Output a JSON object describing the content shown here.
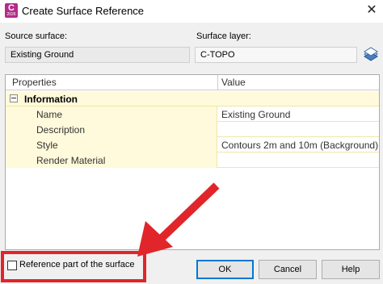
{
  "window": {
    "app_icon_letter": "C",
    "app_icon_year": "2026",
    "title": "Create Surface Reference"
  },
  "source": {
    "label": "Source surface:",
    "value": "Existing Ground"
  },
  "layer": {
    "label": "Surface layer:",
    "value": "C-TOPO"
  },
  "grid": {
    "col_properties": "Properties",
    "col_value": "Value",
    "category": "Information",
    "rows": [
      {
        "name": "Name",
        "value": "Existing Ground"
      },
      {
        "name": "Description",
        "value": ""
      },
      {
        "name": "Style",
        "value": "Contours 2m and 10m (Background)"
      },
      {
        "name": "Render Material",
        "value": ""
      }
    ]
  },
  "reference_part": {
    "label": "Reference part of the surface",
    "checked": false
  },
  "buttons": {
    "ok": "OK",
    "cancel": "Cancel",
    "help": "Help"
  },
  "colors": {
    "annotation": "#e0262a",
    "grid_name_bg": "#fffadb",
    "app_icon": "#b52a8a"
  }
}
